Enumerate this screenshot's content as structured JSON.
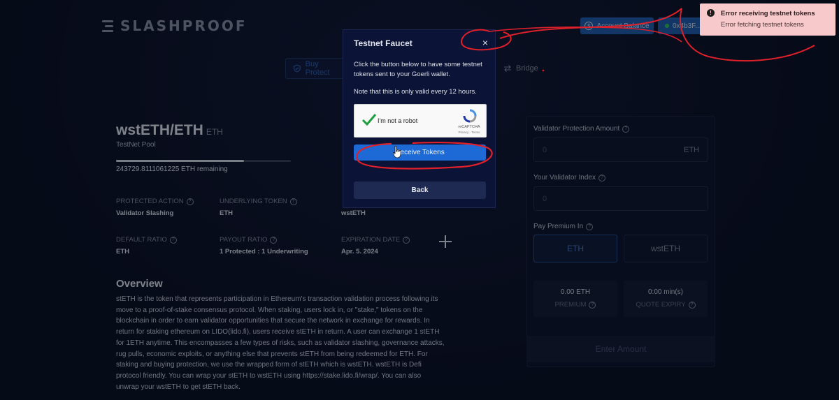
{
  "header": {
    "logo_text": "SLASHPROOF",
    "account_balance_label": "Account Balance",
    "wallet_label": "0x4b3F..."
  },
  "nav": {
    "buy_protection_label": "Buy Protect",
    "bridge_label": "Bridge"
  },
  "pool": {
    "title": "wstETH/ETH",
    "title_unit": "ETH",
    "subtitle": "TestNet Pool",
    "remaining": "243729.8111061225 ETH remaining",
    "progress_fraction": 0.73
  },
  "details": [
    {
      "label": "PROTECTED ACTION",
      "value": "Validator Slashing"
    },
    {
      "label": "UNDERLYING TOKEN",
      "value": "ETH"
    },
    {
      "label": "DEFAULT RATIO",
      "value": "ETH"
    },
    {
      "label": "PAYOUT RATIO",
      "value": "1 Protected : 1 Underwriting"
    },
    {
      "label": "EXPIRATION DATE",
      "value": "Apr. 5. 2024"
    }
  ],
  "partial_detail_value": "wstETH",
  "overview": {
    "heading": "Overview",
    "text": "stETH is the token that represents participation in Ethereum's transaction validation process following its move to a proof-of-stake consensus protocol. When staking, users lock in, or \"stake,\" tokens on the blockchain in order to earn validator opportunities that secure the network in exchange for rewards. In return for staking ethereum on LIDO(lido.fi), users receive stETH in return. A user can exchange 1 stETH for 1ETH anytime. This encompasses a few types of risks, such as validator slashing, governance attacks, rug pulls, economic exploits, or anything else that prevents stETH from being redeemed for ETH. For staking and buying protection, we use the wrapped form of stETH which is wstETH. wstETH is Defi protocol friendly. You can wrap your stETH to wstETH using https://stake.lido.fi/wrap/. You can also unwrap your wstETH to get stETH back."
  },
  "panel": {
    "protection_amount_label": "Validator Protection Amount",
    "protection_amount_value": "0",
    "protection_amount_unit": "ETH",
    "validator_index_label": "Your Validator Index",
    "validator_index_value": "0",
    "pay_premium_label": "Pay Premium In",
    "pay_options": [
      "ETH",
      "wstETH"
    ],
    "premium_value": "0.00 ETH",
    "premium_label": "PREMIUM",
    "quote_expiry_value": "0:00 min(s)",
    "quote_expiry_label": "QUOTE EXPIRY",
    "enter_amount_label": "Enter Amount"
  },
  "modal": {
    "title": "Testnet Faucet",
    "close_glyph": "×",
    "text": "Click the button below to have some testnet tokens sent to your Goerli wallet.",
    "note": "Note that this is only valid every 12 hours.",
    "captcha_label": "I'm not a robot",
    "captcha_brand": "reCAPTCHA",
    "captcha_links": "Privacy - Terms",
    "receive_label": "Receive Tokens",
    "back_label": "Back"
  },
  "toast": {
    "title": "Error receiving testnet tokens",
    "message": "Error fetching testnet tokens",
    "icon_glyph": "!"
  },
  "colors": {
    "background": "#0b1022",
    "accent_blue": "#1d69d6",
    "toast_bg": "#f7c9cb",
    "annotation_red": "#e0202a"
  }
}
